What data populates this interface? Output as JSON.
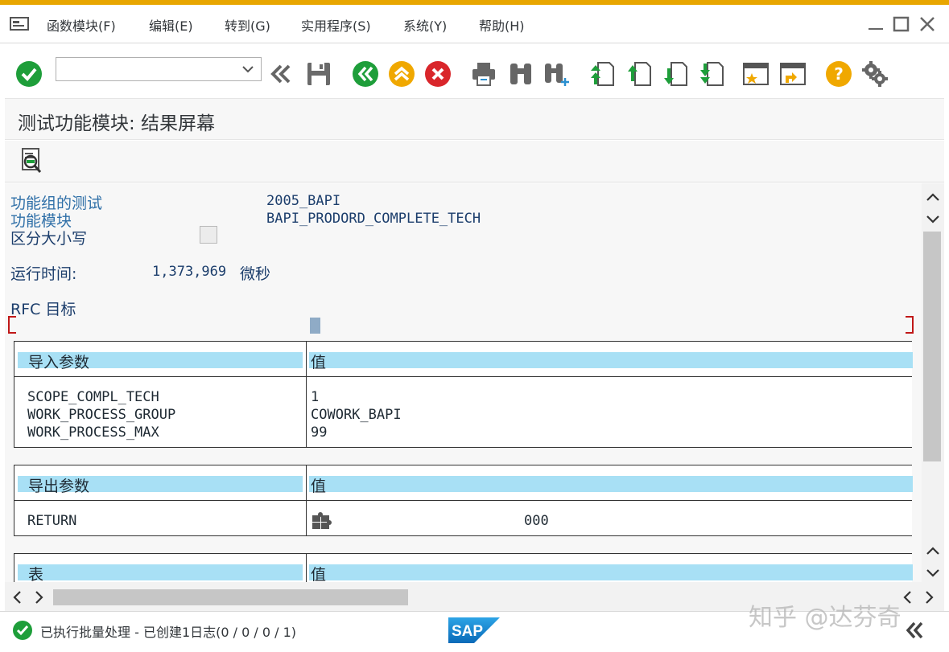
{
  "menubar": {
    "items": [
      "函数模块(F)",
      "编辑(E)",
      "转到(G)",
      "实用程序(S)",
      "系统(Y)",
      "帮助(H)"
    ]
  },
  "toolbar": {
    "command_value": "",
    "icons": [
      "check-icon",
      "dropdown-icon",
      "back-double-icon",
      "save-icon",
      "back-icon",
      "exit-icon",
      "cancel-icon",
      "print-icon",
      "find-icon",
      "find-next-icon",
      "first-page-icon",
      "prev-page-icon",
      "next-page-icon",
      "last-page-icon",
      "new-session-icon",
      "shortcut-icon",
      "help-icon",
      "settings-icon"
    ]
  },
  "title": "测试功能模块: 结果屏幕",
  "content": {
    "function_group_label": "功能组的测试",
    "function_group_value": "2005_BAPI",
    "function_module_label": "功能模块",
    "function_module_value": "BAPI_PRODORD_COMPLETE_TECH",
    "case_sensitive_label": "区分大小写",
    "case_sensitive_checked": false,
    "runtime_label": "运行时间:",
    "runtime_value": "1,373,969",
    "runtime_unit": "微秒",
    "rfc_label": "RFC 目标",
    "import_table": {
      "header_param": "导入参数",
      "header_value": "值",
      "rows": [
        {
          "name": "SCOPE_COMPL_TECH",
          "value": "1"
        },
        {
          "name": "WORK_PROCESS_GROUP",
          "value": "COWORK_BAPI"
        },
        {
          "name": "WORK_PROCESS_MAX",
          "value": "99"
        }
      ]
    },
    "export_table": {
      "header_param": "导出参数",
      "header_value": "值",
      "rows": [
        {
          "name": "RETURN",
          "value": "000"
        }
      ]
    },
    "tables_table": {
      "header_param": "表",
      "header_value": "值"
    }
  },
  "statusbar": {
    "message": "已执行批量处理 - 已创建1日志(0 / 0 / 0 / 1)",
    "logo": "SAP",
    "watermark": "知乎 @达芬奇"
  },
  "colors": {
    "accent_top": "#e8a600",
    "header_fill": "#a8e0f5",
    "label_blue": "#3070a8",
    "ok_green": "#1e9e3a"
  }
}
